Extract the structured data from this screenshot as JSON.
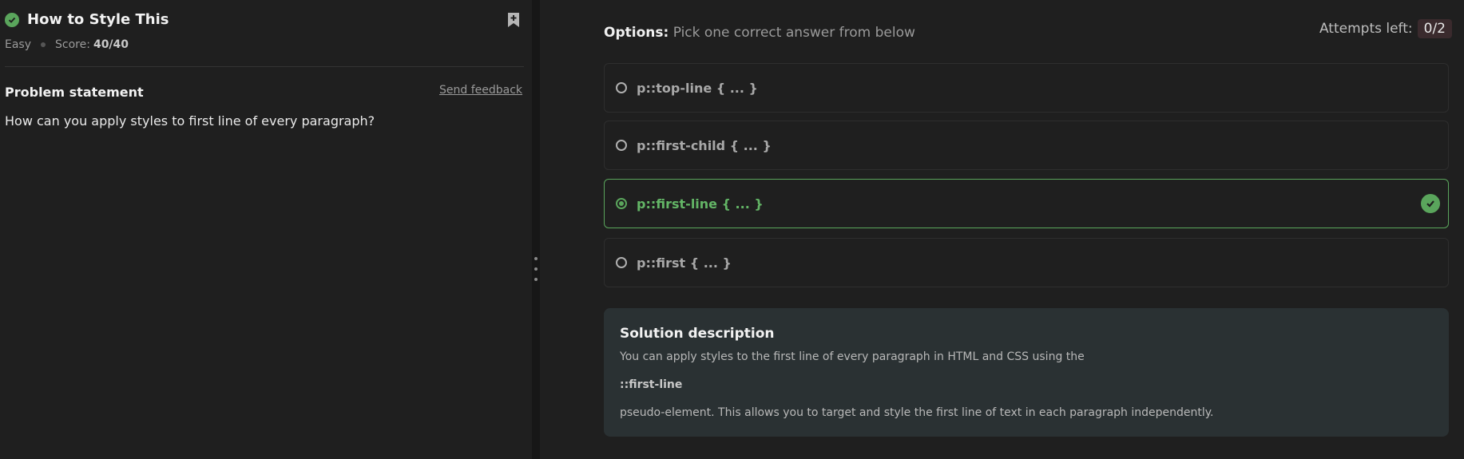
{
  "problem": {
    "title": "How to Style This",
    "difficulty": "Easy",
    "score_label": "Score:",
    "score_value": "40/40",
    "statement_heading": "Problem statement",
    "feedback_link": "Send feedback",
    "statement_text": "How can you apply styles to first line of every paragraph?"
  },
  "quiz": {
    "options_label": "Options:",
    "options_hint": "Pick one correct answer from below",
    "attempts_label": "Attempts left:",
    "attempts_value": "0/2",
    "options": [
      {
        "text": "p::top-line { ... }",
        "selected": false
      },
      {
        "text": "p::first-child { ... }",
        "selected": false
      },
      {
        "text": "p::first-line { ... }",
        "selected": true
      },
      {
        "text": "p::first { ... }",
        "selected": false
      }
    ]
  },
  "solution": {
    "heading": "Solution description",
    "line1": "You can apply styles to the first line of every paragraph in HTML and CSS using the",
    "code": "::first-line",
    "line2": "pseudo-element. This allows you to target and style the first line of text in each paragraph independently."
  },
  "colors": {
    "accent_green": "#5aa55c",
    "background": "#1f1f1f",
    "solution_bg": "#2a3133"
  },
  "icons": [
    "check-circle-icon",
    "bookmark-add-icon",
    "radio-icon",
    "check-icon",
    "drag-handle-icon"
  ]
}
